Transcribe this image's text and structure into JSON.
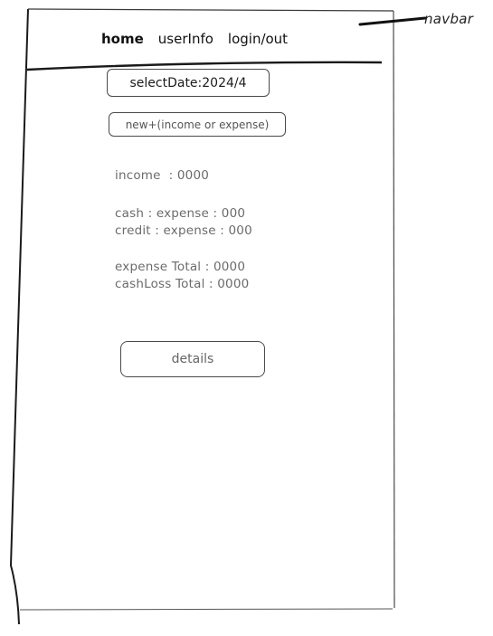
{
  "annotation": {
    "navbar_label": "navbar"
  },
  "navbar": {
    "items": [
      {
        "label": "home"
      },
      {
        "label": "userInfo"
      },
      {
        "label": "login/out"
      }
    ]
  },
  "controls": {
    "select_date": "selectDate:2024/4",
    "new_entry": "new+(income or expense)",
    "details": "details"
  },
  "summary": {
    "income": "income  : 0000",
    "cash_expense": "cash : expense : 000",
    "credit_expense": "credit : expense : 000",
    "expense_total": "expense Total : 0000",
    "cashloss_total": "cashLoss Total : 0000"
  },
  "colors": {
    "stroke": "#1a1a1a",
    "button_border": "#4a4a4a",
    "muted_text": "#6b6b6b"
  }
}
